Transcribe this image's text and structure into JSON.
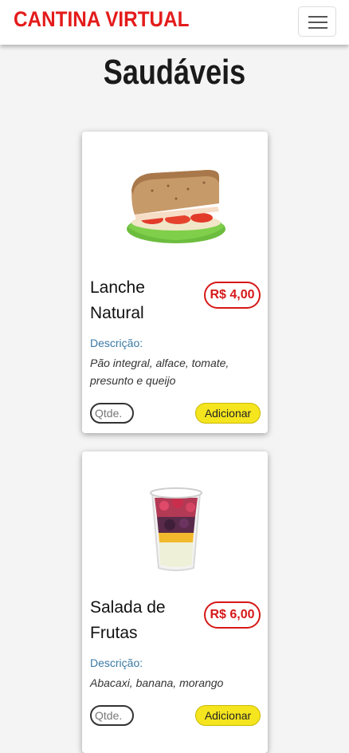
{
  "navbar": {
    "brand": "CANTINA VIRTUAL",
    "menu_icon": "hamburger-menu-icon"
  },
  "page": {
    "title": "Saudáveis"
  },
  "products": [
    {
      "name": "Lanche Natural",
      "price": "R$ 4,00",
      "description_label": "Descrição:",
      "description": "Pão integral, alface, tomate, presunto e queijo",
      "qty_placeholder": "Qtde.",
      "add_label": "Adicionar",
      "image": "sandwich-image"
    },
    {
      "name": "Salada de Frutas",
      "price": "R$ 6,00",
      "description_label": "Descrição:",
      "description": "Abacaxi, banana, morango",
      "qty_placeholder": "Qtde.",
      "add_label": "Adicionar",
      "image": "fruit-salad-cup-image"
    }
  ],
  "colors": {
    "brand_red": "#e41b1b",
    "price_red": "#d61818",
    "button_yellow": "#f5e51f",
    "label_blue": "#3b7aa6"
  }
}
